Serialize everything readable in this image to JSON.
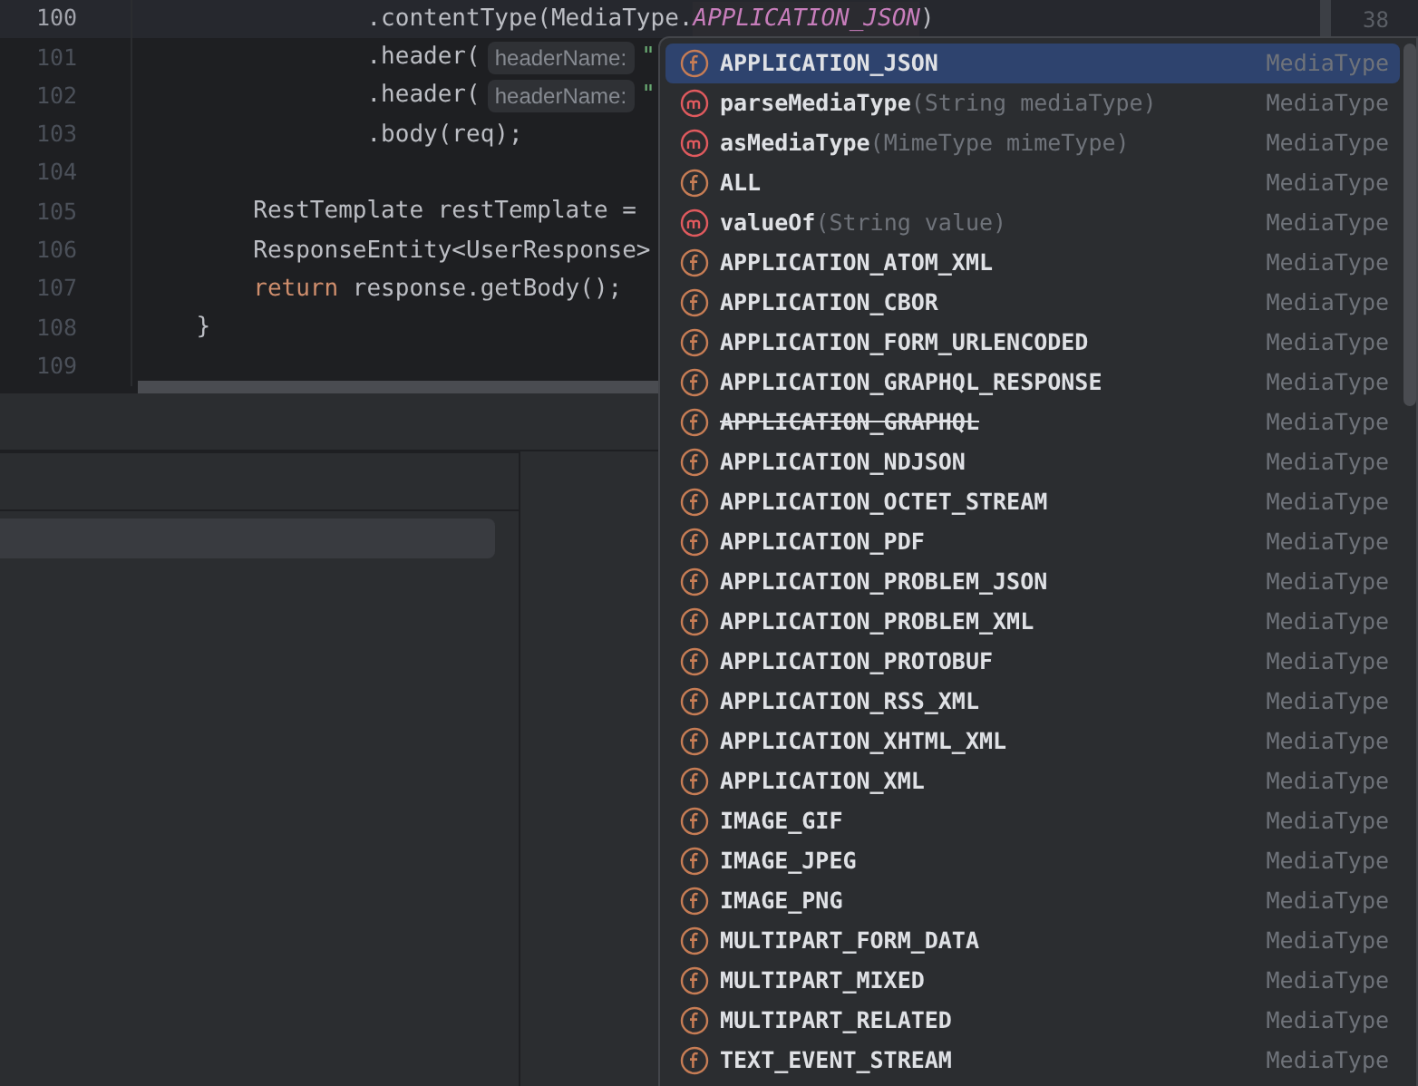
{
  "editor": {
    "lines": [
      {
        "number": "100",
        "current": true,
        "tokens": [
          {
            "kind": "plain",
            "text": "                .contentType(MediaType."
          },
          {
            "kind": "constant",
            "text": "APPLICATION_JSON"
          },
          {
            "kind": "plain",
            "text": ")"
          }
        ]
      },
      {
        "number": "101",
        "current": false,
        "tokens": [
          {
            "kind": "plain",
            "text": "                .header("
          },
          {
            "kind": "hint",
            "text": "headerName:"
          },
          {
            "kind": "string",
            "text": "\""
          }
        ]
      },
      {
        "number": "102",
        "current": false,
        "tokens": [
          {
            "kind": "plain",
            "text": "                .header("
          },
          {
            "kind": "hint",
            "text": "headerName:"
          },
          {
            "kind": "string",
            "text": "\""
          }
        ]
      },
      {
        "number": "103",
        "current": false,
        "tokens": [
          {
            "kind": "plain",
            "text": "                .body(req);"
          }
        ]
      },
      {
        "number": "104",
        "current": false
      },
      {
        "number": "105",
        "current": false,
        "tokens": [
          {
            "kind": "plain",
            "text": "        RestTemplate restTemplate ="
          }
        ]
      },
      {
        "number": "106",
        "current": false,
        "tokens": [
          {
            "kind": "plain",
            "text": "        ResponseEntity<UserResponse>"
          }
        ]
      },
      {
        "number": "107",
        "current": false,
        "tokens": [
          {
            "kind": "keyword",
            "text": "        return"
          },
          {
            "kind": "plain",
            "text": " response.getBody();"
          }
        ]
      },
      {
        "number": "108",
        "current": false,
        "tokens": [
          {
            "kind": "plain",
            "text": "    }"
          }
        ]
      },
      {
        "number": "109",
        "current": false
      }
    ],
    "marker": "38"
  },
  "completion": {
    "items": [
      {
        "kind": "field",
        "name": "APPLICATION_JSON",
        "type": "MediaType",
        "selected": true,
        "deprecated": false
      },
      {
        "kind": "method",
        "name": "parseMediaType",
        "params": "(String mediaType)",
        "type": "MediaType",
        "selected": false,
        "deprecated": false
      },
      {
        "kind": "method",
        "name": "asMediaType",
        "params": "(MimeType mimeType)",
        "type": "MediaType",
        "selected": false,
        "deprecated": false
      },
      {
        "kind": "field",
        "name": "ALL",
        "type": "MediaType",
        "selected": false,
        "deprecated": false
      },
      {
        "kind": "method",
        "name": "valueOf",
        "params": "(String value)",
        "type": "MediaType",
        "selected": false,
        "deprecated": false
      },
      {
        "kind": "field",
        "name": "APPLICATION_ATOM_XML",
        "type": "MediaType",
        "selected": false,
        "deprecated": false
      },
      {
        "kind": "field",
        "name": "APPLICATION_CBOR",
        "type": "MediaType",
        "selected": false,
        "deprecated": false
      },
      {
        "kind": "field",
        "name": "APPLICATION_FORM_URLENCODED",
        "type": "MediaType",
        "selected": false,
        "deprecated": false
      },
      {
        "kind": "field",
        "name": "APPLICATION_GRAPHQL_RESPONSE",
        "type": "MediaType",
        "selected": false,
        "deprecated": false
      },
      {
        "kind": "field",
        "name": "APPLICATION_GRAPHQL",
        "type": "MediaType",
        "selected": false,
        "deprecated": true
      },
      {
        "kind": "field",
        "name": "APPLICATION_NDJSON",
        "type": "MediaType",
        "selected": false,
        "deprecated": false
      },
      {
        "kind": "field",
        "name": "APPLICATION_OCTET_STREAM",
        "type": "MediaType",
        "selected": false,
        "deprecated": false
      },
      {
        "kind": "field",
        "name": "APPLICATION_PDF",
        "type": "MediaType",
        "selected": false,
        "deprecated": false
      },
      {
        "kind": "field",
        "name": "APPLICATION_PROBLEM_JSON",
        "type": "MediaType",
        "selected": false,
        "deprecated": false
      },
      {
        "kind": "field",
        "name": "APPLICATION_PROBLEM_XML",
        "type": "MediaType",
        "selected": false,
        "deprecated": false
      },
      {
        "kind": "field",
        "name": "APPLICATION_PROTOBUF",
        "type": "MediaType",
        "selected": false,
        "deprecated": false
      },
      {
        "kind": "field",
        "name": "APPLICATION_RSS_XML",
        "type": "MediaType",
        "selected": false,
        "deprecated": false
      },
      {
        "kind": "field",
        "name": "APPLICATION_XHTML_XML",
        "type": "MediaType",
        "selected": false,
        "deprecated": false
      },
      {
        "kind": "field",
        "name": "APPLICATION_XML",
        "type": "MediaType",
        "selected": false,
        "deprecated": false
      },
      {
        "kind": "field",
        "name": "IMAGE_GIF",
        "type": "MediaType",
        "selected": false,
        "deprecated": false
      },
      {
        "kind": "field",
        "name": "IMAGE_JPEG",
        "type": "MediaType",
        "selected": false,
        "deprecated": false
      },
      {
        "kind": "field",
        "name": "IMAGE_PNG",
        "type": "MediaType",
        "selected": false,
        "deprecated": false
      },
      {
        "kind": "field",
        "name": "MULTIPART_FORM_DATA",
        "type": "MediaType",
        "selected": false,
        "deprecated": false
      },
      {
        "kind": "field",
        "name": "MULTIPART_MIXED",
        "type": "MediaType",
        "selected": false,
        "deprecated": false
      },
      {
        "kind": "field",
        "name": "MULTIPART_RELATED",
        "type": "MediaType",
        "selected": false,
        "deprecated": false
      },
      {
        "kind": "field",
        "name": "TEXT_EVENT_STREAM",
        "type": "MediaType",
        "selected": false,
        "deprecated": false
      }
    ]
  }
}
